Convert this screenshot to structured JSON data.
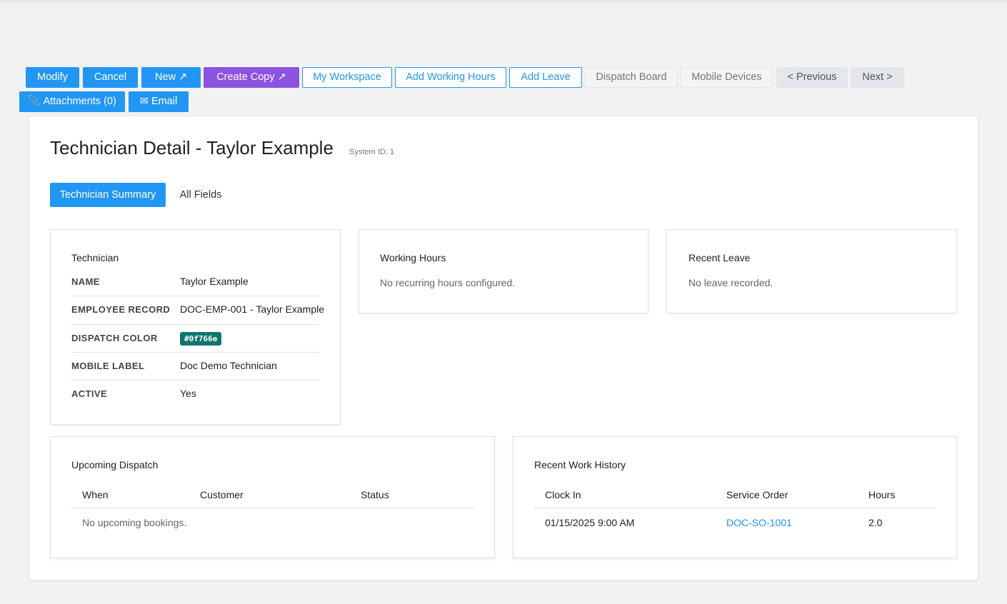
{
  "toolbar": {
    "modify": "Modify",
    "cancel": "Cancel",
    "new": "New ↗",
    "create_copy": "Create Copy ↗",
    "my_workspace": "My Workspace",
    "add_working_hours": "Add Working Hours",
    "add_leave": "Add Leave",
    "dispatch_board": "Dispatch Board",
    "mobile_devices": "Mobile Devices",
    "previous": "< Previous",
    "next": "Next >",
    "attachments": "📎 Attachments (0)",
    "email": "✉ Email"
  },
  "page": {
    "title": "Technician Detail - Taylor Example",
    "system_id": "System ID: 1"
  },
  "tabs": {
    "summary": "Technician Summary",
    "all_fields": "All Fields"
  },
  "technician": {
    "title": "Technician",
    "fields": [
      {
        "label": "NAME",
        "value": "Taylor Example"
      },
      {
        "label": "EMPLOYEE RECORD",
        "value": "DOC-EMP-001 - Taylor Example"
      },
      {
        "label": "DISPATCH COLOR",
        "value": "#0f766e"
      },
      {
        "label": "MOBILE LABEL",
        "value": "Doc Demo Technician"
      },
      {
        "label": "ACTIVE",
        "value": "Yes"
      }
    ],
    "dispatch_color_hex": "#0f766e"
  },
  "working_hours": {
    "title": "Working Hours",
    "empty": "No recurring hours configured."
  },
  "recent_leave": {
    "title": "Recent Leave",
    "empty": "No leave recorded."
  },
  "upcoming_dispatch": {
    "title": "Upcoming Dispatch",
    "columns": [
      "When",
      "Customer",
      "Status"
    ],
    "empty": "No upcoming bookings."
  },
  "recent_work_history": {
    "title": "Recent Work History",
    "columns": [
      "Clock In",
      "Service Order",
      "Hours"
    ],
    "rows": [
      {
        "clock_in": "01/15/2025 9:00 AM",
        "service_order": "DOC-SO-1001",
        "hours": "2.0"
      }
    ]
  },
  "colors": {
    "primary": "#2196f3",
    "purple": "#8c52e0"
  }
}
